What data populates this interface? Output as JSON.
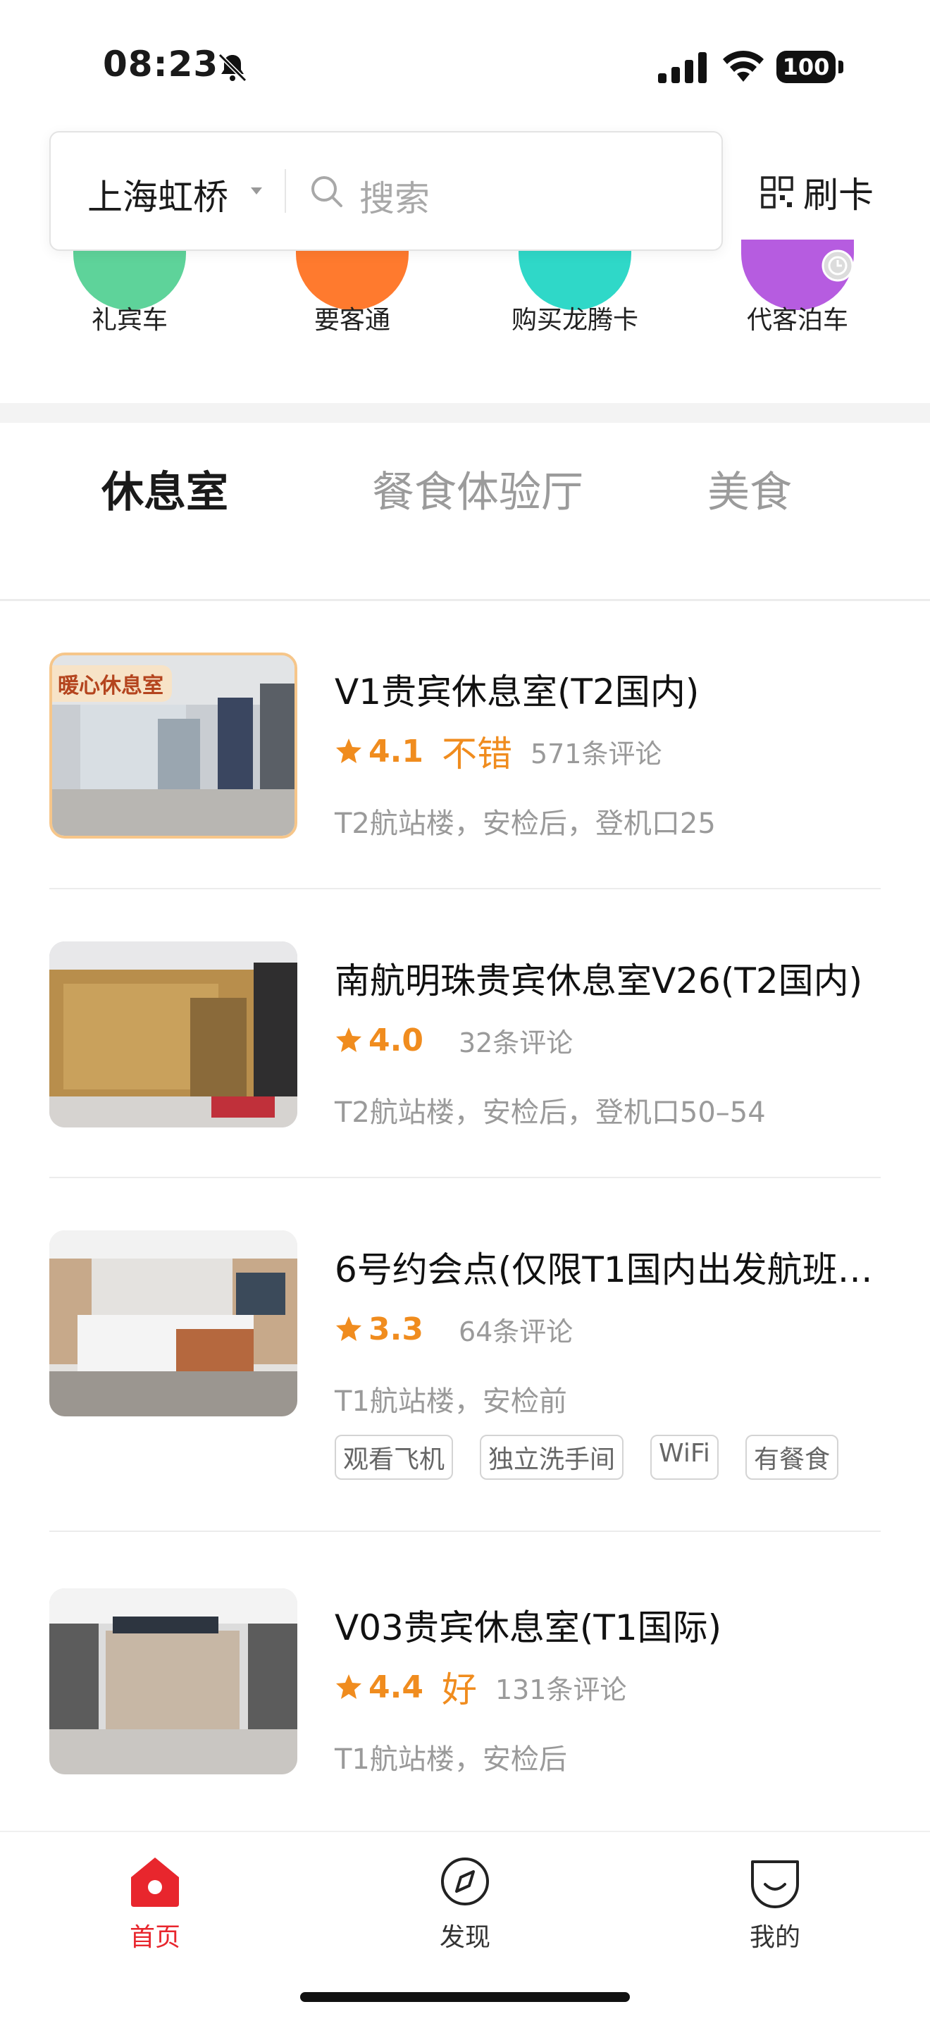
{
  "status_bar": {
    "time": "08:23",
    "battery": "100"
  },
  "header": {
    "city": "上海虹桥",
    "search_placeholder": "搜索",
    "card_button": "刷卡"
  },
  "quick_actions": [
    {
      "label": "礼宾车",
      "color": "#5ed39a"
    },
    {
      "label": "要客通",
      "color": "#ff7a2e"
    },
    {
      "label": "购买龙腾卡",
      "color": "#2fd8c8"
    },
    {
      "label": "代客泊车",
      "color": "#b65ce0"
    }
  ],
  "tabs": [
    {
      "label": "休息室",
      "active": true
    },
    {
      "label": "餐食体验厅",
      "active": false
    },
    {
      "label": "美食",
      "active": false
    }
  ],
  "lounges": [
    {
      "title": "V1贵宾休息室(T2国内)",
      "score": "4.1",
      "verdict": "不错",
      "reviews": "571条评论",
      "location": "T2航站楼，安检后，登机口25",
      "badge": "暖心休息室",
      "tags": []
    },
    {
      "title": "南航明珠贵宾休息室V26(T2国内)",
      "score": "4.0",
      "verdict": "",
      "reviews": "32条评论",
      "location": "T2航站楼，安检后，登机口50–54",
      "badge": "",
      "tags": []
    },
    {
      "title": "6号约会点(仅限T1国内出发航班…",
      "score": "3.3",
      "verdict": "",
      "reviews": "64条评论",
      "location": "T1航站楼，安检前",
      "badge": "",
      "tags": [
        "观看飞机",
        "独立洗手间",
        "WiFi",
        "有餐食"
      ]
    },
    {
      "title": "V03贵宾休息室(T1国际)",
      "score": "4.4",
      "verdict": "好",
      "reviews": "131条评论",
      "location": "T1航站楼，安检后",
      "badge": "",
      "tags": []
    }
  ],
  "bottom_nav": [
    {
      "label": "首页",
      "icon": "home-icon",
      "active": true
    },
    {
      "label": "发现",
      "icon": "compass-icon",
      "active": false
    },
    {
      "label": "我的",
      "icon": "profile-icon",
      "active": false
    }
  ],
  "colors": {
    "accent_orange": "#f08c1e",
    "active_red": "#e8262d",
    "muted_gray": "#9a9a9a"
  }
}
